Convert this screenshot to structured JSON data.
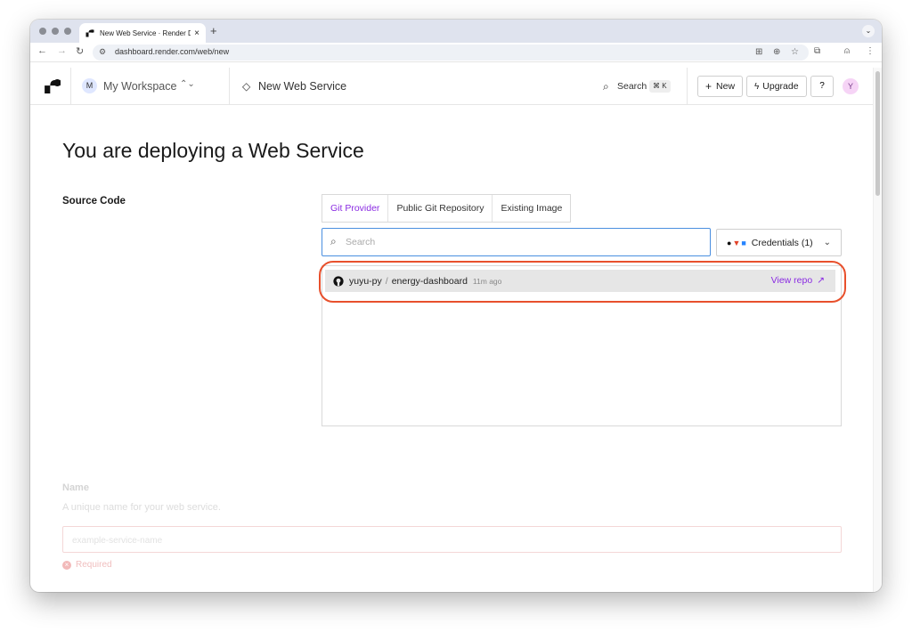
{
  "browser": {
    "tab_title": "New Web Service · Render D",
    "tab_close": "×",
    "new_tab": "+",
    "url": "dashboard.render.com/web/new"
  },
  "header": {
    "workspace_initial": "M",
    "workspace_name": "My Workspace",
    "service_label": "New Web Service",
    "search_label": "Search",
    "search_shortcut": "⌘ K",
    "new_label": "New",
    "upgrade_label": "Upgrade",
    "user_initial": "Y"
  },
  "page": {
    "title": "You are deploying a Web Service"
  },
  "source_code": {
    "label": "Source Code",
    "tabs": [
      {
        "label": "Git Provider",
        "active": true
      },
      {
        "label": "Public Git Repository",
        "active": false
      },
      {
        "label": "Existing Image",
        "active": false
      }
    ],
    "search_placeholder": "Search",
    "credentials_label": "Credentials (1)",
    "repos": [
      {
        "owner": "yuyu-py",
        "separator": "/",
        "name": "energy-dashboard",
        "updated": "11m ago",
        "action": "View repo"
      }
    ]
  },
  "name_section": {
    "label": "Name",
    "help": "A unique name for your web service.",
    "placeholder": "example-service-name",
    "required_text": "Required"
  },
  "colors": {
    "accent": "#8a2be2",
    "highlight": "#e8502c",
    "focus": "#4a8fe0"
  }
}
